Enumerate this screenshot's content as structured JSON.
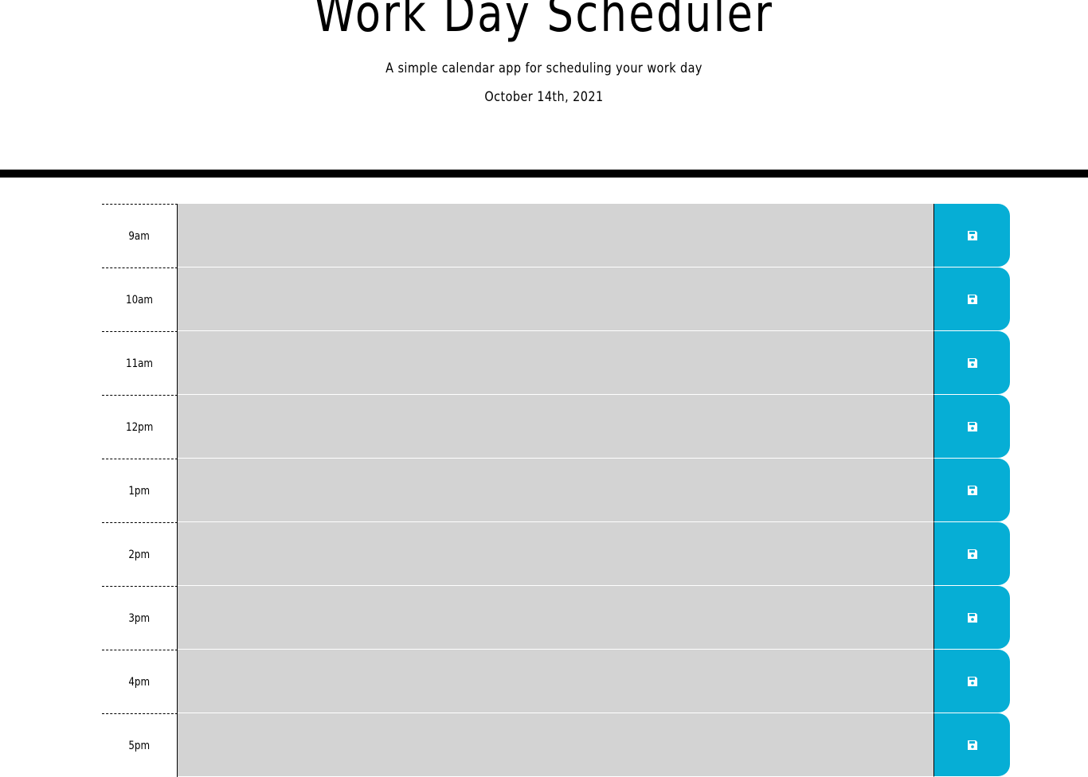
{
  "header": {
    "title": "Work Day Scheduler",
    "lead": "A simple calendar app for scheduling your work day",
    "current_day": "October 14th, 2021"
  },
  "colors": {
    "save_button": "#06aed5",
    "text_area": "#d3d3d3",
    "divider": "#000000"
  },
  "timeblocks": [
    {
      "hour": "9am",
      "description": "",
      "save_icon": "save-icon"
    },
    {
      "hour": "10am",
      "description": "",
      "save_icon": "save-icon"
    },
    {
      "hour": "11am",
      "description": "",
      "save_icon": "save-icon"
    },
    {
      "hour": "12pm",
      "description": "",
      "save_icon": "save-icon"
    },
    {
      "hour": "1pm",
      "description": "",
      "save_icon": "save-icon"
    },
    {
      "hour": "2pm",
      "description": "",
      "save_icon": "save-icon"
    },
    {
      "hour": "3pm",
      "description": "",
      "save_icon": "save-icon"
    },
    {
      "hour": "4pm",
      "description": "",
      "save_icon": "save-icon"
    },
    {
      "hour": "5pm",
      "description": "",
      "save_icon": "save-icon"
    }
  ]
}
